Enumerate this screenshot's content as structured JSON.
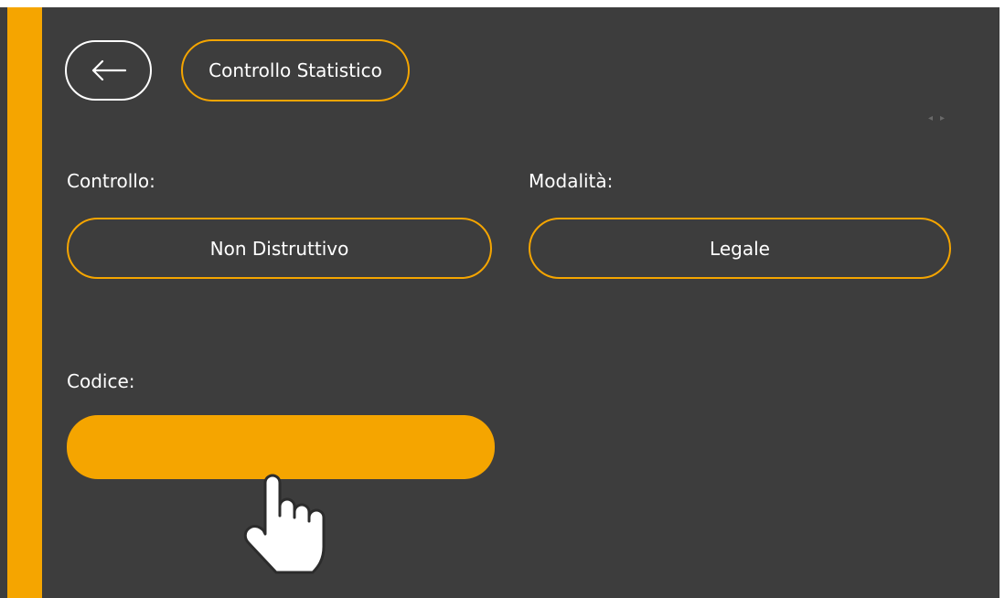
{
  "header": {
    "back_icon": "arrow-left-icon",
    "title": "Controllo Statistico",
    "pager_icons": [
      "chevron-left-icon",
      "chevron-right-icon"
    ],
    "pager_glyphs": "◂▸"
  },
  "form": {
    "controllo": {
      "label": "Controllo:",
      "value": "Non Distruttivo"
    },
    "modalita": {
      "label": "Modalità:",
      "value": "Legale"
    },
    "codice": {
      "label": "Codice:",
      "value": ""
    }
  },
  "cursor": {
    "icon": "hand-pointer-icon"
  },
  "colors": {
    "background": "#3d3d3d",
    "accent": "#f5a500",
    "text": "#ffffff",
    "outer": "#ffffff"
  }
}
